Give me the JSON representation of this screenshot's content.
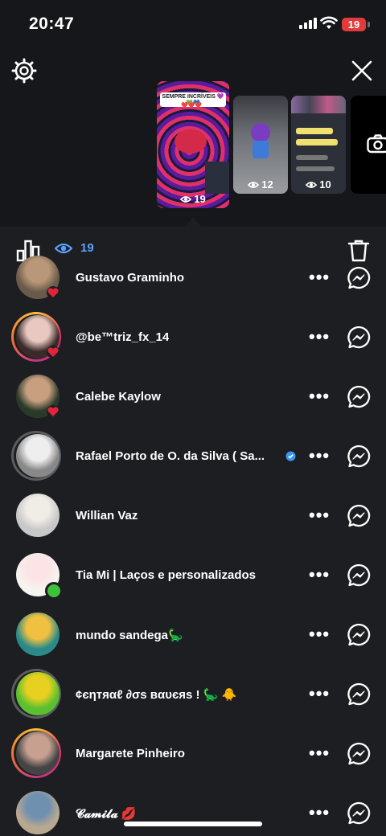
{
  "status_bar": {
    "time": "20:47",
    "battery": "19"
  },
  "story_thumbs": [
    {
      "views": "19",
      "caption": "SEMPRE INCRÍVEIS 💜💚💙",
      "hearts": "❤️❤️❤️"
    },
    {
      "views": "12"
    },
    {
      "views": "10"
    }
  ],
  "toolbar": {
    "viewer_count": "19"
  },
  "viewers": [
    {
      "name": "Gustavo Graminho",
      "liked": true,
      "online": false,
      "ring": "none"
    },
    {
      "name": "@be™triz_fx_14",
      "liked": true,
      "online": false,
      "ring": "gradient"
    },
    {
      "name": "Calebe Kaylow",
      "liked": true,
      "online": false,
      "ring": "none"
    },
    {
      "name": "Rafael Porto de O. da Silva  ( Sa...",
      "liked": false,
      "online": false,
      "ring": "gray",
      "verified": true
    },
    {
      "name": "Willian Vaz",
      "liked": false,
      "online": false,
      "ring": "none"
    },
    {
      "name": "Tia Mi | Laços e personalizados",
      "liked": false,
      "online": true,
      "ring": "none"
    },
    {
      "name": "mundo sandega🦕",
      "liked": false,
      "online": false,
      "ring": "none"
    },
    {
      "name": "¢єηтяαℓ ∂σѕ вαυєяѕ ! 🦕 🐥",
      "liked": false,
      "online": false,
      "ring": "gray"
    },
    {
      "name": "Margarete Pinheiro",
      "liked": false,
      "online": false,
      "ring": "gradient"
    },
    {
      "name": "𝓒𝓪𝓶𝓲𝓵𝓪 💋",
      "liked": false,
      "online": false,
      "ring": "none"
    }
  ],
  "row_actions": {
    "more_label": "•••"
  },
  "colors": {
    "accent": "#5aa0ff",
    "heart": "#e0243a",
    "online": "#3ec13a",
    "background": "#1c1e21"
  }
}
